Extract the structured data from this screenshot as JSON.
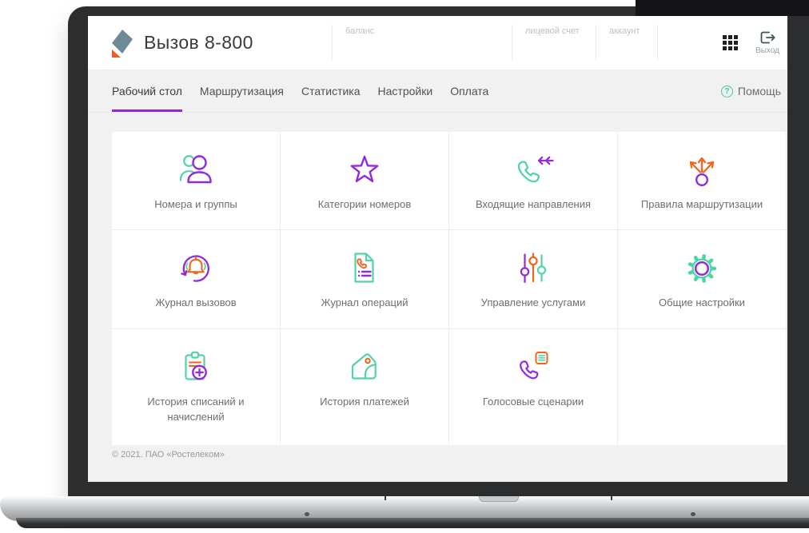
{
  "app": {
    "title": "Вызов 8-800",
    "logo": "rostelecom-logo"
  },
  "header": {
    "info_fields": [
      {
        "label": "баланс",
        "value": ""
      },
      {
        "label": "лицевой счет",
        "value": ""
      },
      {
        "label": "аккаунт",
        "value": ""
      }
    ],
    "apps_icon": "apps-grid-icon",
    "logout": {
      "label": "Выход",
      "icon": "logout-icon"
    }
  },
  "nav": {
    "tabs": [
      {
        "label": "Рабочий стол",
        "active": true
      },
      {
        "label": "Маршрутизация",
        "active": false
      },
      {
        "label": "Статистика",
        "active": false
      },
      {
        "label": "Настройки",
        "active": false
      },
      {
        "label": "Оплата",
        "active": false
      }
    ],
    "help": {
      "label": "Помощь",
      "icon": "question-circle-icon"
    }
  },
  "tiles": [
    {
      "label": "Номера и группы",
      "icon": "users-icon"
    },
    {
      "label": "Категории номеров",
      "icon": "star-icon"
    },
    {
      "label": "Входящие направления",
      "icon": "incoming-call-icon"
    },
    {
      "label": "Правила маршрутизации",
      "icon": "routing-arrows-icon"
    },
    {
      "label": "Журнал вызовов",
      "icon": "call-log-bell-icon"
    },
    {
      "label": "Журнал операций",
      "icon": "document-phone-icon"
    },
    {
      "label": "Управление услугами",
      "icon": "sliders-icon"
    },
    {
      "label": "Общие настройки",
      "icon": "gear-icon"
    },
    {
      "label": "История списаний и начислений",
      "icon": "clipboard-plus-icon"
    },
    {
      "label": "История платежей",
      "icon": "wallet-icon"
    },
    {
      "label": "Голосовые сценарии",
      "icon": "phone-script-icon"
    }
  ],
  "footer": {
    "copyright": "© 2021. ПАО «Ростелеком»"
  },
  "colors": {
    "purple": "#9229da",
    "green": "#4fd5a5",
    "orange": "#f2641c",
    "tab_underline": "#8e2bd3",
    "help_green": "#3ecf96",
    "logo_slate": "#6f8a97",
    "logo_orange": "#ec5b23"
  }
}
